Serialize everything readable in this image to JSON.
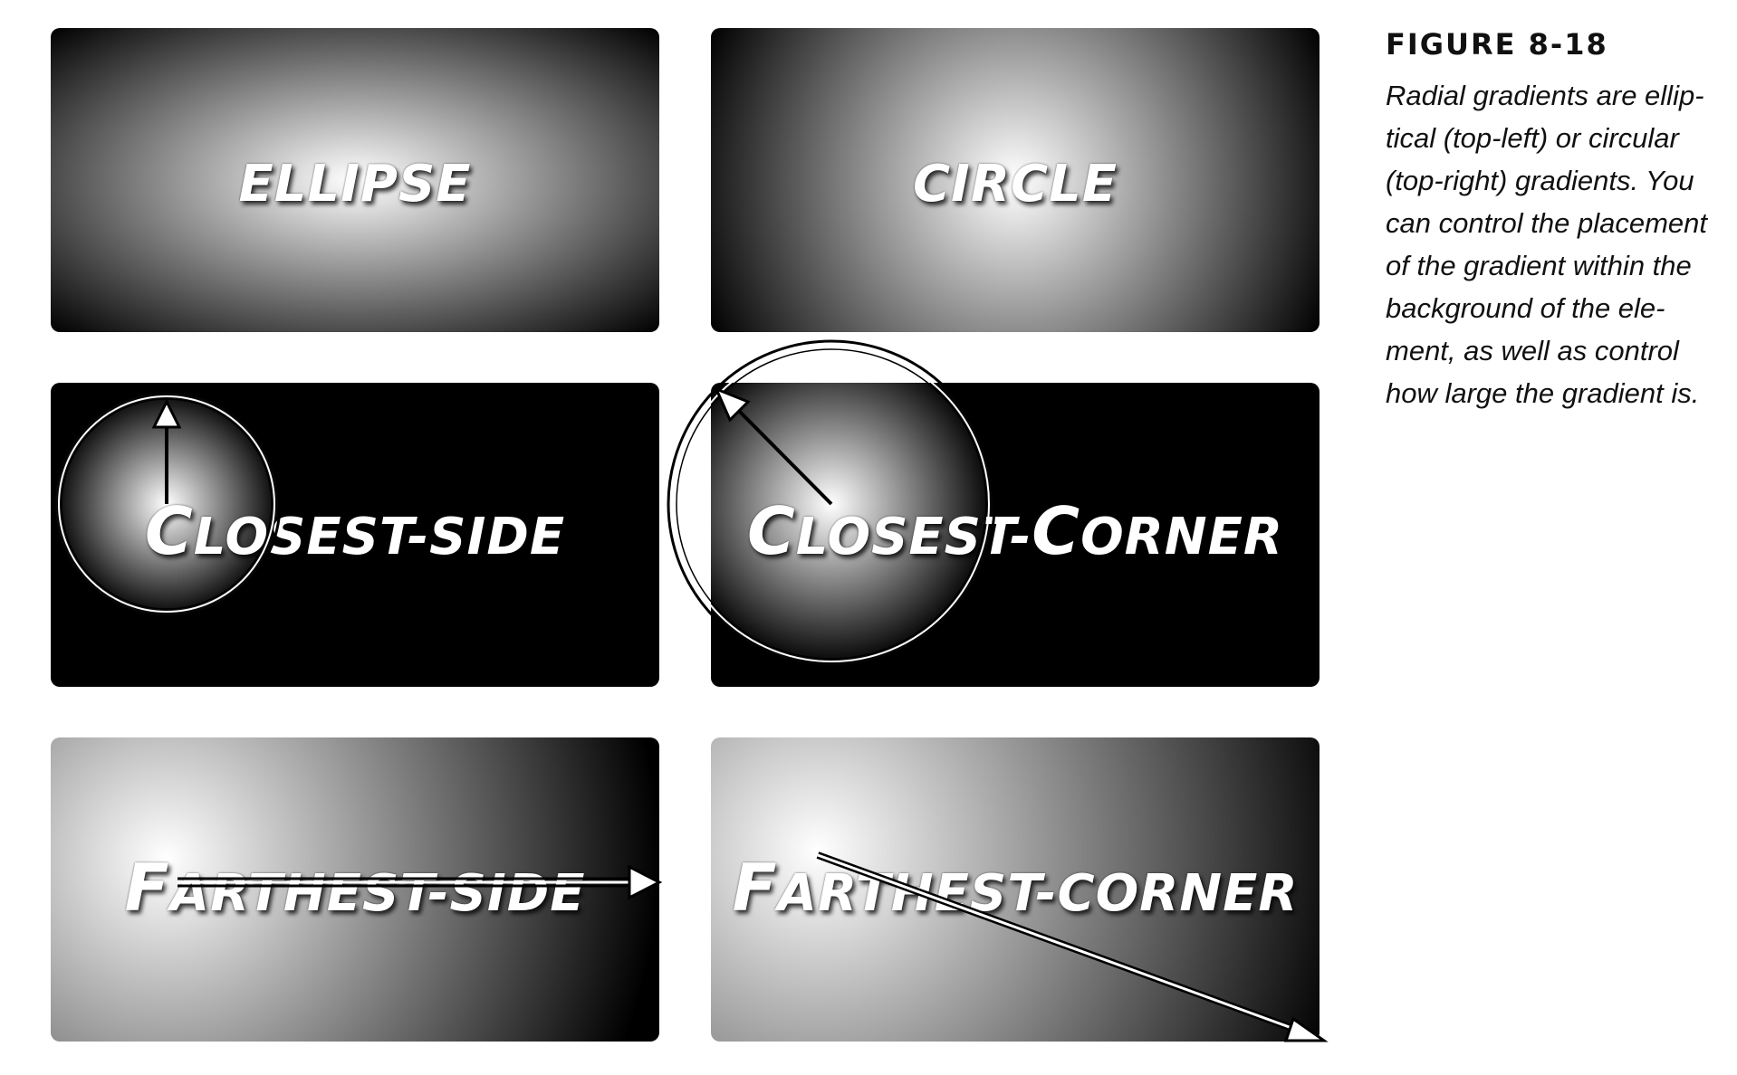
{
  "figure": {
    "title": "FIGURE 8-18",
    "caption_lines": [
      "Radial gradients are ellip-",
      "tical (top-left) or circular",
      "(top-right) gradients. You",
      "can control the placement",
      "of the gradient within the",
      "background of the ele-",
      "ment, as well as control",
      "how large the gradient is."
    ]
  },
  "panels": {
    "ellipse": "ELLIPSE",
    "circle": "CIRCLE",
    "closest_side": {
      "cap": "C",
      "rest": "LOSEST-SIDE"
    },
    "closest_corner": {
      "cap1": "C",
      "mid": "LOSEST-",
      "cap2": "C",
      "rest": "ORNER"
    },
    "farthest_side": {
      "cap": "F",
      "rest": "ARTHEST-SIDE"
    },
    "farthest_corner": {
      "cap": "F",
      "rest": "ARTHEST-CORNER"
    }
  },
  "colors": {
    "gradient_center": "#ffffff",
    "gradient_edge": "#000000",
    "annotation_stroke": "#000000",
    "caption_text": "#111111"
  }
}
